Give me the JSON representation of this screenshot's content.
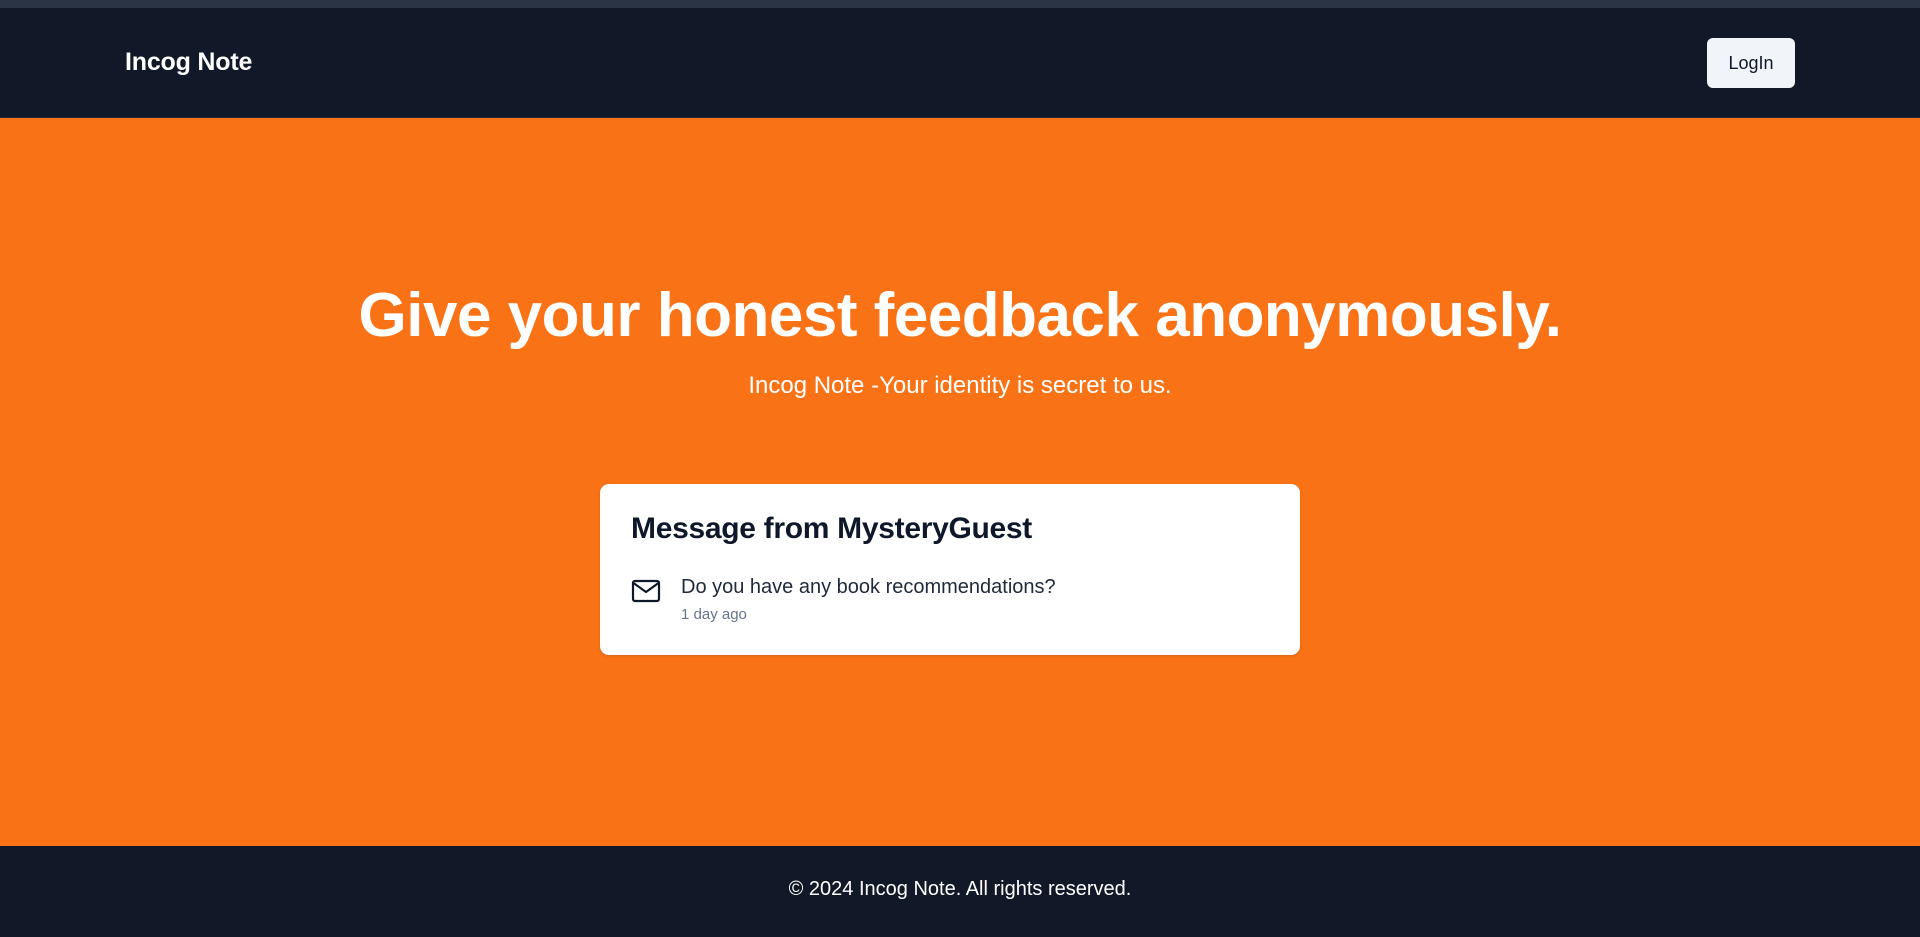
{
  "navbar": {
    "brand": "Incog Note",
    "login_label": "LogIn"
  },
  "hero": {
    "title": "Give your honest feedback anonymously.",
    "subtitle": "Incog Note -Your identity is secret to us."
  },
  "message_card": {
    "title": "Message from MysteryGuest",
    "icon": "mail-icon",
    "message": "Do you have any book recommendations?",
    "time": "1 day ago"
  },
  "footer": {
    "text": "© 2024 Incog Note. All rights reserved."
  },
  "colors": {
    "hero_background": "#f97316",
    "nav_background": "#111827",
    "button_background": "#f1f5f9"
  }
}
